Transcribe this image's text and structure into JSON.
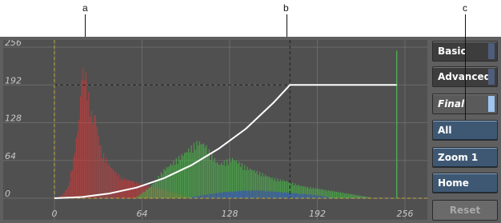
{
  "callouts": [
    "a",
    "b",
    "c"
  ],
  "panel": {
    "basic_label": "Basic",
    "advanced_label": "Advanced",
    "final_label": "Final",
    "all_label": "All",
    "zoom_label": "Zoom 1",
    "home_label": "Home",
    "reset_label": "Reset"
  },
  "chart_data": {
    "type": "area",
    "title": "",
    "xlabel": "",
    "ylabel": "",
    "xlim": [
      0,
      256
    ],
    "ylim": [
      0,
      256
    ],
    "x_ticks": [
      "0",
      "64",
      "128",
      "192",
      "256"
    ],
    "y_ticks": [
      "0",
      "64",
      "128",
      "192",
      "256"
    ],
    "grid": true,
    "output_clip_level": 192,
    "input_clip_point": 172,
    "curve": {
      "name": "curve",
      "color": "#ffffff",
      "points": [
        [
          0,
          0
        ],
        [
          20,
          2
        ],
        [
          40,
          8
        ],
        [
          60,
          18
        ],
        [
          80,
          34
        ],
        [
          100,
          56
        ],
        [
          120,
          84
        ],
        [
          140,
          118
        ],
        [
          160,
          162
        ],
        [
          172,
          192
        ],
        [
          250,
          192
        ]
      ]
    },
    "series": [
      {
        "name": "red",
        "color": "#cc3a3a",
        "x": [
          0,
          6,
          10,
          14,
          18,
          20,
          22,
          24,
          26,
          28,
          30,
          32,
          35,
          40,
          45,
          50,
          60,
          70,
          80,
          90,
          100
        ],
        "values": [
          0,
          6,
          20,
          70,
          140,
          220,
          228,
          200,
          160,
          140,
          150,
          110,
          80,
          60,
          45,
          35,
          28,
          22,
          15,
          8,
          0
        ]
      },
      {
        "name": "green",
        "color": "#48b848",
        "x": [
          60,
          70,
          80,
          90,
          95,
          100,
          105,
          110,
          115,
          120,
          125,
          130,
          140,
          150,
          160,
          170,
          180,
          190,
          200,
          210,
          220,
          230
        ],
        "values": [
          2,
          20,
          50,
          70,
          80,
          90,
          100,
          95,
          75,
          60,
          65,
          70,
          55,
          45,
          35,
          30,
          22,
          18,
          14,
          10,
          6,
          2
        ]
      },
      {
        "name": "blue",
        "color": "#3b5fb5",
        "x": [
          100,
          110,
          120,
          130,
          140,
          150,
          160,
          170,
          180,
          190,
          200
        ],
        "values": [
          2,
          6,
          10,
          12,
          14,
          14,
          12,
          10,
          8,
          6,
          2
        ]
      }
    ]
  }
}
